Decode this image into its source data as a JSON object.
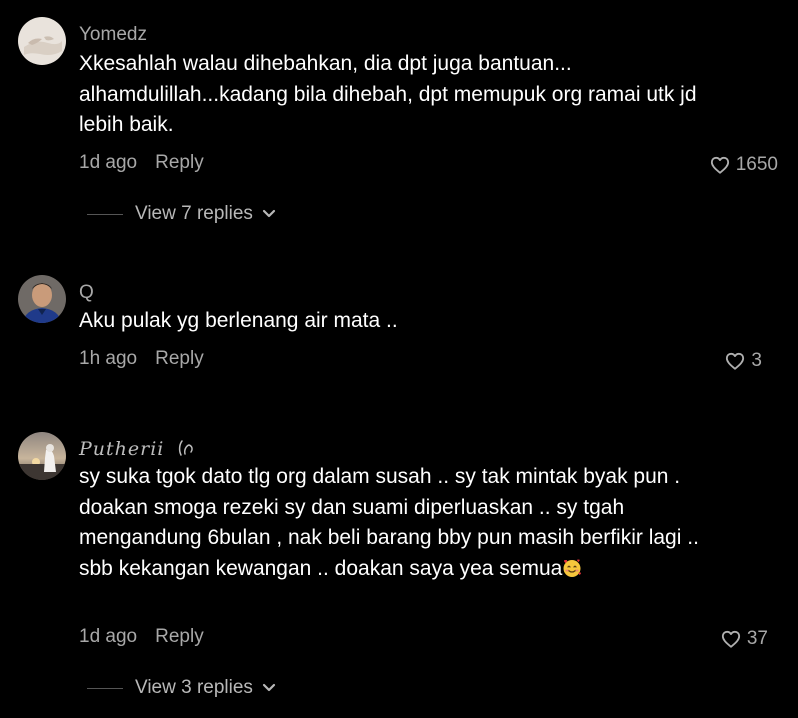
{
  "colors": {
    "background": "#000000",
    "primary_text": "#ffffff",
    "secondary_text": "#a8a8a8"
  },
  "comments": [
    {
      "username": "Yomedz",
      "avatar": "avatar-photo",
      "text": "Xkesahlah walau dihebahkan, dia dpt juga bantuan... alhamdulillah...kadang bila dihebah, dpt memupuk org ramai utk jd lebih baik.",
      "time": "1d ago",
      "reply_label": "Reply",
      "likes": "1650",
      "like_icon": "heart-outline-icon",
      "view_replies": "View 7 replies"
    },
    {
      "username": "Q",
      "avatar": "avatar-photo",
      "text": "Aku pulak yg berlenang air mata ..",
      "time": "1h ago",
      "reply_label": "Reply",
      "likes": "3",
      "like_icon": "heart-outline-icon"
    },
    {
      "username": "Putherii",
      "username_icon": "pen-nib-icon",
      "avatar": "avatar-photo",
      "text": "sy suka tgok dato tlg org dalam susah .. sy tak mintak byak pun . doakan smoga rezeki sy dan suami diperluaskan .. sy tgah mengandung 6bulan , nak beli barang bby pun masih berfikir lagi .. sbb kekangan kewangan .. doakan saya yea semua",
      "text_emoji": "smiling-face-with-hearts-emoji",
      "time": "1d ago",
      "reply_label": "Reply",
      "likes": "37",
      "like_icon": "heart-outline-icon",
      "view_replies": "View 3 replies"
    }
  ]
}
